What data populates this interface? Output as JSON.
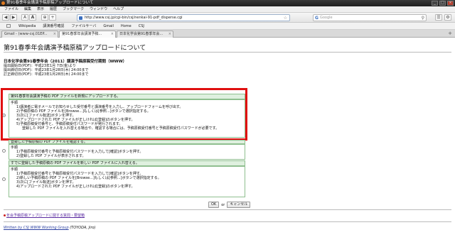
{
  "window": {
    "title": "第91春季年会講演予稿原稿アップロードについて",
    "controls": [
      "_",
      "□",
      "×"
    ]
  },
  "menu": [
    "ファイル",
    "編集",
    "表示",
    "履歴",
    "ブックマーク",
    "ウィンドウ",
    "ヘルプ"
  ],
  "nav": {
    "back": "◀",
    "forward": "▶",
    "reload": "A",
    "home": "A",
    "stop": "⊕",
    "add": "+",
    "url": "http://www.csj.jp/cgi-bin/csj/nenkai-91-pdf_disperse.cgi",
    "search_placeholder": "Google"
  },
  "bookmarks": [
    "Wikipedia",
    "講演番号確認",
    "ファイルサーバ",
    "Gmail",
    "Home",
    "CSJ"
  ],
  "tabs": [
    {
      "label": "Gmail - (www-csj.01EP...",
      "active": false
    },
    {
      "label": "第91春季年会講演予稿...",
      "active": true
    },
    {
      "label": "日本化学会第91春季年会...",
      "active": false
    }
  ],
  "page": {
    "heading": "第91春季年会講演予稿原稿アップロードについて",
    "phase_title": "日本化学会第91春季年会（2011）講演予稿原稿受付期間（WWW）",
    "deadlines": [
      "提出開始日(PDF)：平成23年1月 7日(金)より",
      "提出締切日(PDF)：平成23年1月28日(木) 24:00まで",
      "訂正締切日(PDF)：平成23年1月28日(木) 24:00まで"
    ],
    "sections": [
      {
        "head": "第91春季年会講演予稿の PDF ファイルを新規にアップロードする。",
        "label": "手順",
        "steps": [
          "1)講演者に電子メールでお知らせした受付番号と講演番号を入力し、アップロードフォームを呼び出す。",
          "2)予稿原稿の PDF ファイルを[Browse...]もしくは[参照...]ボタンで選択指定する。",
          "3)次に[ファイル転送]ボタンを押す。",
          "4)アップロードされた PDF ファイルが正しければ[登録]のボタンを押す。",
          "5)予稿原稿受付番号と、予稿原稿受付パスワードが発行されます。"
        ],
        "note": "登録した PDF ファイルを入れ替える場合や、確認する場合には、予稿原稿受付番号と予稿原稿受付パスワードが必要です。"
      },
      {
        "head": "登録した予稿原稿の PDF ファイルを確認する。",
        "label": "手順",
        "steps": [
          "1)予稿原稿受付番号と予稿原稿受付パスワードを入力して[確認]ボタンを押す。",
          "2)登録した PDF ファイルが表示されます。"
        ]
      },
      {
        "head": "すでに登録した予稿原稿の PDF ファイルを新しい PDF ファイルに入れ替える。",
        "label": "手順",
        "steps": [
          "1)予稿原稿受付番号と予稿原稿受付パスワードを入力して[確認]ボタンを押す。",
          "2)新しい予稿原稿の PDF ファイルを[Browse...]もしくは[参照...]ボタンで選択指定する。",
          "3)次に[ファイル転送]ボタンを押す。",
          "4)アップロードされた PDF ファイルが正しければ[登録]のボタンを押す。"
        ]
      }
    ],
    "ok_label": "OK",
    "or_label": "or",
    "cancel_label": "キャンセル",
    "link_text": "年会予稿原稿アップロードに関する質問・要望箱",
    "footer_link": "Written by CSJ WWW Working Group",
    "footer_rest": " (TOYODA, Jiro)"
  }
}
